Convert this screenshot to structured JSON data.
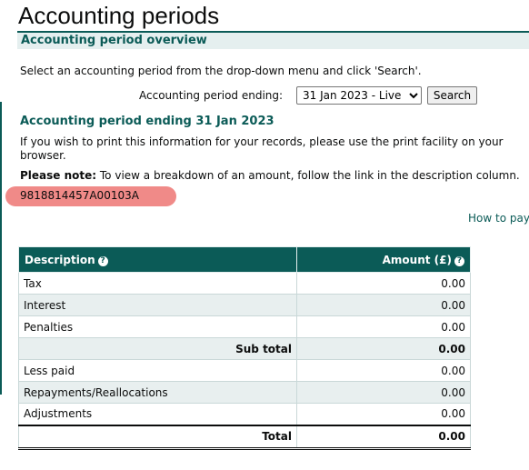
{
  "page": {
    "title": "Accounting periods",
    "section_title": "Accounting period overview",
    "intro_text": "Select an accounting period from the drop-down menu and click 'Search'."
  },
  "filter": {
    "label": "Accounting period ending:",
    "selected_value": "31 Jan 2023 - Live",
    "search_label": "Search"
  },
  "period": {
    "heading": "Accounting period ending 31 Jan 2023",
    "print_note": "If you wish to print this information for your records, please use the print facility on your browser.",
    "note_label": "Please note:",
    "note_text": " To view a breakdown of an amount, follow the link in the description column.",
    "reference": "9818814457A00103A",
    "how_to_pay": "How to pay"
  },
  "colors": {
    "accent": "#0b5b57",
    "highlight": "#f08a88",
    "row_shade": "#e8efef"
  },
  "table": {
    "headers": {
      "description": "Description",
      "amount": "Amount (£)",
      "help_icon": "help-icon"
    },
    "rows": [
      {
        "description": "Tax",
        "amount": "0.00"
      },
      {
        "description": "Interest",
        "amount": "0.00"
      },
      {
        "description": "Penalties",
        "amount": "0.00"
      }
    ],
    "subtotal": {
      "label": "Sub total",
      "amount": "0.00"
    },
    "rows2": [
      {
        "description": "Less paid",
        "amount": "0.00"
      },
      {
        "description": "Repayments/Reallocations",
        "amount": "0.00"
      },
      {
        "description": "Adjustments",
        "amount": "0.00"
      }
    ],
    "total": {
      "label": "Total",
      "amount": "0.00"
    }
  }
}
